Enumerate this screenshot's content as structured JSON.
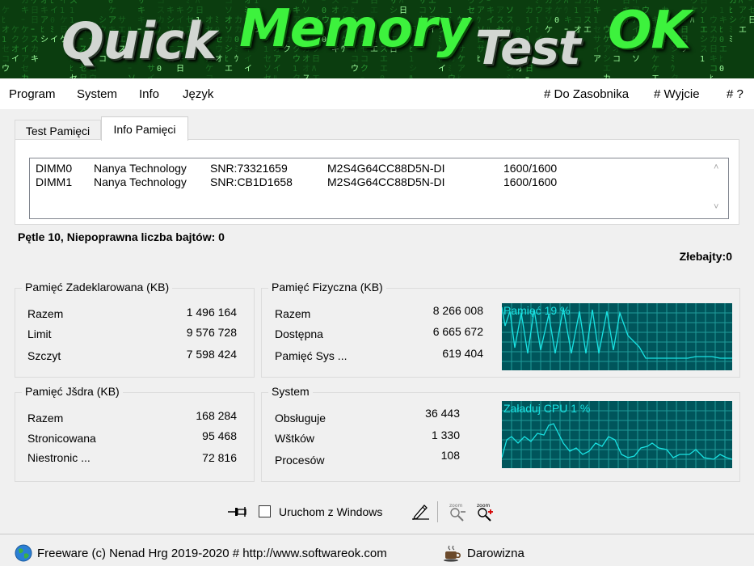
{
  "banner": {
    "logo_quick": "Quick",
    "logo_memory": "Memory",
    "logo_test": "Test",
    "logo_ok": "OK"
  },
  "menu": {
    "program": "Program",
    "system": "System",
    "info": "Info",
    "language": "Język",
    "to_tray": "# Do Zasobnika",
    "exit": "# Wyjcie",
    "help": "# ?"
  },
  "tabs": {
    "memory_test": "Test Pamięci",
    "memory_info": "Info Pamięci"
  },
  "modules": [
    {
      "slot": "DIMM0",
      "vendor": "Nanya Technology",
      "serial": "SNR:73321659",
      "part": "M2S4G64CC88D5N-DI",
      "speed": "1600/1600"
    },
    {
      "slot": "DIMM1",
      "vendor": "Nanya Technology",
      "serial": "SNR:CB1D1658",
      "part": "M2S4G64CC88D5N-DI",
      "speed": "1600/1600"
    }
  ],
  "status": {
    "loops": "Pętle 10, Niepoprawna liczba bajtów: 0",
    "bad_bytes": "Złebajty:0"
  },
  "committed": {
    "title": "Pamięć Zadeklarowana (KB)",
    "rows": [
      {
        "label": "Razem",
        "value": "1 496 164"
      },
      {
        "label": "Limit",
        "value": "9 576 728"
      },
      {
        "label": "Szczyt",
        "value": "7 598 424"
      }
    ]
  },
  "physical": {
    "title": "Pamięć Fizyczna  (KB)",
    "rows": [
      {
        "label": "Razem",
        "value": "8 266 008"
      },
      {
        "label": "Dostępna",
        "value": "6 665 672"
      },
      {
        "label": "Pamięć Sys ...",
        "value": "619 404"
      }
    ],
    "graph_label": "Pamięć 19 %"
  },
  "kernel": {
    "title": "Pamięć Jšdra (KB)",
    "rows": [
      {
        "label": "Razem",
        "value": "168 284"
      },
      {
        "label": "Stronicowana",
        "value": "95 468"
      },
      {
        "label": "Niestronic ...",
        "value": "72 816"
      }
    ]
  },
  "system": {
    "title": "System",
    "rows": [
      {
        "label": "Obsługuje",
        "value": "36 443"
      },
      {
        "label": "Wštków",
        "value": "1 330"
      },
      {
        "label": "Procesów",
        "value": "108"
      }
    ],
    "graph_label": "Załaduj CPU 1 %"
  },
  "bottom": {
    "autostart_label": "Uruchom z Windows",
    "autostart_checked": false,
    "zoom_out_caption": "zoom",
    "zoom_in_caption": "zoom"
  },
  "footer": {
    "copyright": "Freeware (c) Nenad Hrg 2019-2020 # http://www.softwareok.com",
    "donate": "Darowizna"
  },
  "colors": {
    "banner_bg": "#0b3d0f",
    "logo_green": "#3df23d",
    "graph_bg": "#00555b",
    "graph_line": "#19e3e3"
  },
  "icons": [
    "pin-icon",
    "pencil-icon",
    "zoom-out-icon",
    "zoom-in-icon",
    "globe-icon",
    "coffee-icon",
    "scroll-up-icon",
    "scroll-down-icon"
  ]
}
